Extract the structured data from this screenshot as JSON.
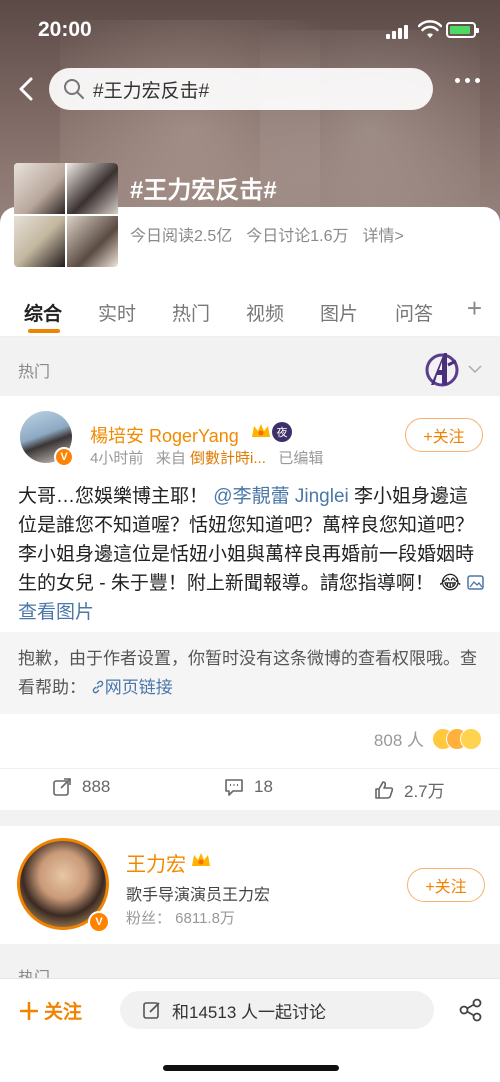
{
  "status": {
    "time": "20:00"
  },
  "topbar": {
    "search_text": "#王力宏反击#"
  },
  "topic": {
    "title": "#王力宏反击#",
    "read_today": "今日阅读2.5亿",
    "discuss_today": "今日讨论1.6万",
    "detail": "详情>"
  },
  "tabs": [
    "综合",
    "实时",
    "热门",
    "视频",
    "图片",
    "问答"
  ],
  "section": {
    "hot": "热门"
  },
  "post": {
    "author": "楊培安 RogerYang",
    "meta_time": "4小时前",
    "meta_from": "来自",
    "meta_source": "倒數計時i...",
    "meta_edited": "已编辑",
    "follow_label": "+关注",
    "text_1": "大哥…您娛樂博主耶！",
    "mention": "@李靚蕾 Jinglei",
    "text_2": " 李小姐身邊這位是誰您不知道喔？恬妞您知道吧？萬梓良您知道吧？李小姐身邊這位是恬妞小姐與萬梓良再婚前一段婚姻時生的女兒 - 朱于豐！附上新聞報導。請您指導啊！",
    "view_images": "查看图片",
    "notice_text": "抱歉，由于作者设置，你暂时没有这条微博的查看权限哦。查看帮助：",
    "notice_link": "网页链接",
    "likes_count": "808 人",
    "repost": "888",
    "comment": "18",
    "like": "2.7万"
  },
  "user_card": {
    "name": "王力宏",
    "desc": "歌手导演演员王力宏",
    "fans": "粉丝：  6811.8万",
    "follow_label": "+关注"
  },
  "bottom": {
    "follow": "关注",
    "discuss": "和14513 人一起讨论"
  },
  "colors": {
    "accent": "#f08300",
    "link": "#4b77a8"
  }
}
